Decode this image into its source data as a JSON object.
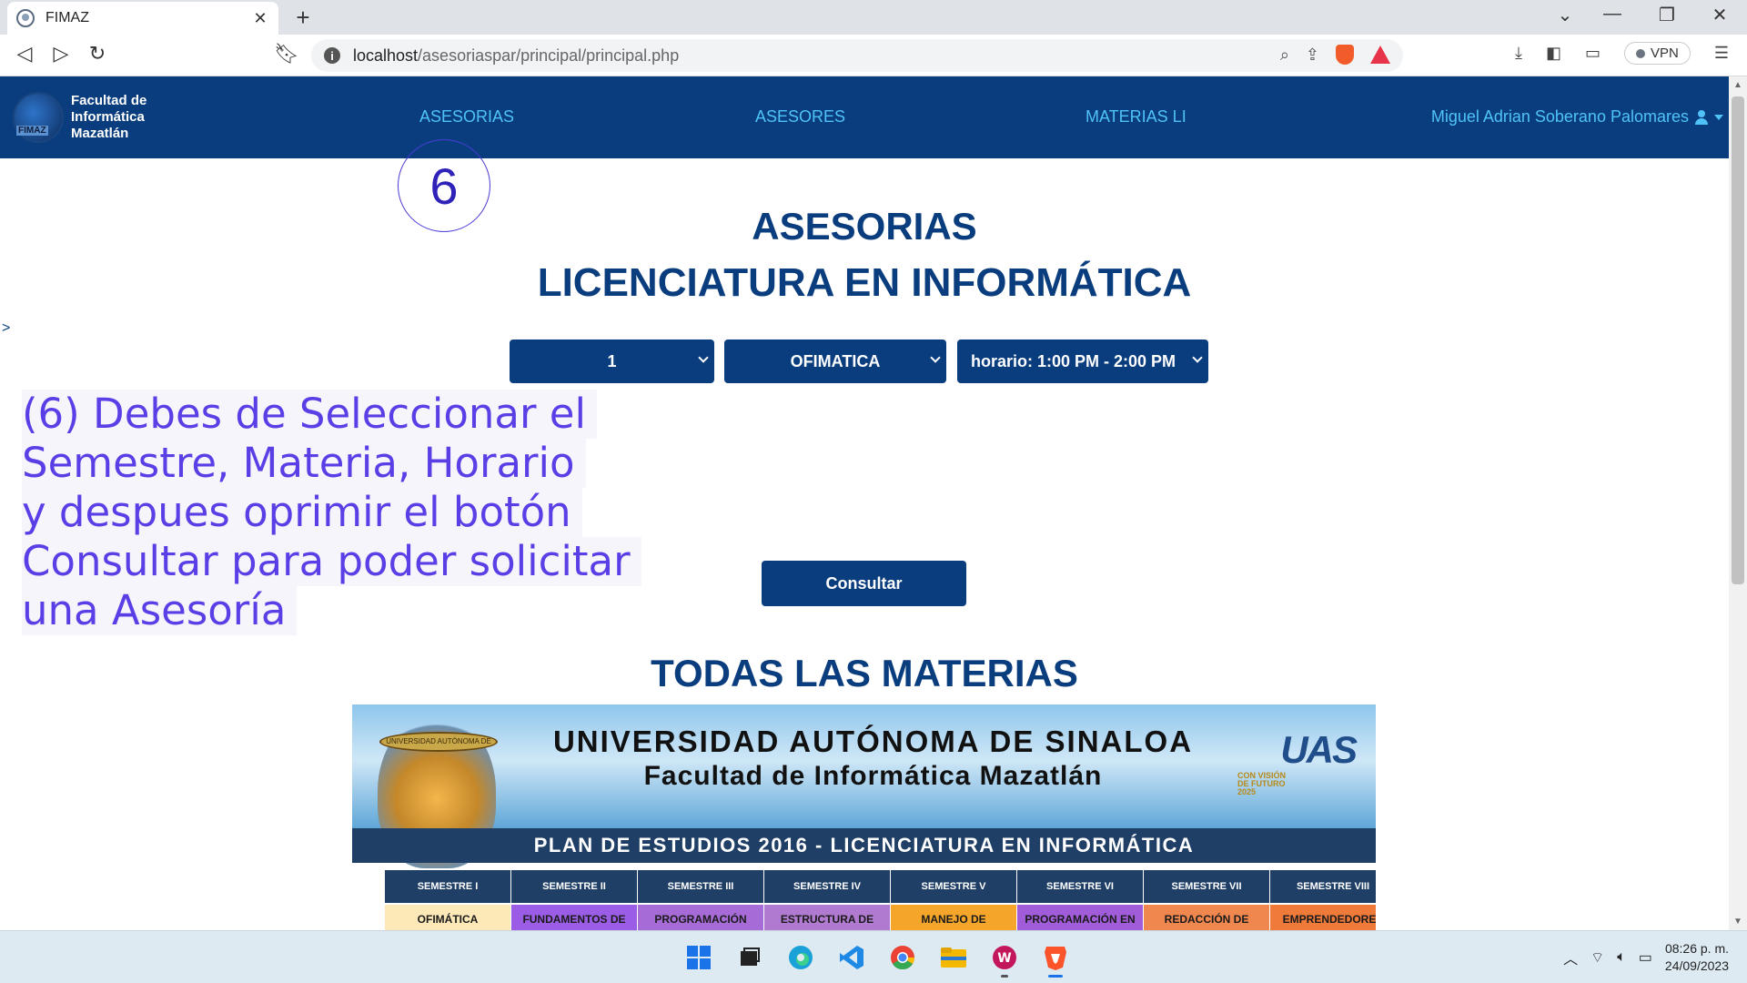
{
  "browser": {
    "tab_title": "FIMAZ",
    "tab_close": "✕",
    "new_tab": "+",
    "url_host": "localhost",
    "url_path": "/asesoriaspar/principal/principal.php",
    "vpn_label": "VPN"
  },
  "header": {
    "logo_text": [
      "Facultad de",
      "Informática",
      "Mazatlán"
    ],
    "logo_mark_text": "FIMAZ",
    "nav": [
      "ASESORIAS",
      "ASESORES",
      "MATERIAS LI"
    ],
    "user_name": "Miguel Adrian Soberano Palomares"
  },
  "main": {
    "step_number": "6",
    "title_line1": "ASESORIAS",
    "title_line2": "LICENCIATURA EN INFORMÁTICA",
    "stray_char": ">",
    "selects": {
      "semestre": "1",
      "materia": "OFIMATICA",
      "horario": "horario: 1:00 PM - 2:00 PM"
    },
    "annotation_lines": [
      "(6) Debes de Seleccionar el",
      "Semestre, Materia, Horario",
      "y despues oprimir el botón",
      "Consultar para poder solicitar",
      "una Asesoría"
    ],
    "consult_button": "Consultar",
    "all_subjects_title": "TODAS LAS MATERIAS"
  },
  "plan": {
    "university": "UNIVERSIDAD AUTÓNOMA DE SINALOA",
    "faculty": "Facultad de Informática Mazatlán",
    "uas_logo": "UAS",
    "vision_text": "CON VISIÓN DE FUTURO 2025",
    "seal_text": "UNIVERSIDAD AUTÓNOMA DE SINALOA",
    "subtitle": "PLAN DE ESTUDIOS 2016 - LICENCIATURA EN INFORMÁTICA",
    "semesters": [
      "SEMESTRE I",
      "SEMESTRE II",
      "SEMESTRE III",
      "SEMESTRE IV",
      "SEMESTRE V",
      "SEMESTRE VI",
      "SEMESTRE VII",
      "SEMESTRE VIII"
    ],
    "first_row": [
      "OFIMÁTICA",
      "FUNDAMENTOS DE",
      "PROGRAMACIÓN",
      "ESTRUCTURA DE",
      "MANEJO DE",
      "PROGRAMACIÓN EN",
      "REDACCIÓN DE",
      "EMPRENDEDORES"
    ],
    "first_row_colors": [
      "#fde8b8",
      "#9b5de5",
      "#a66bd6",
      "#b07ad0",
      "#f4a52a",
      "#a15cd9",
      "#f0874e",
      "#f07a3a"
    ]
  },
  "taskbar": {
    "time": "08:26 p. m.",
    "date": "24/09/2023"
  }
}
